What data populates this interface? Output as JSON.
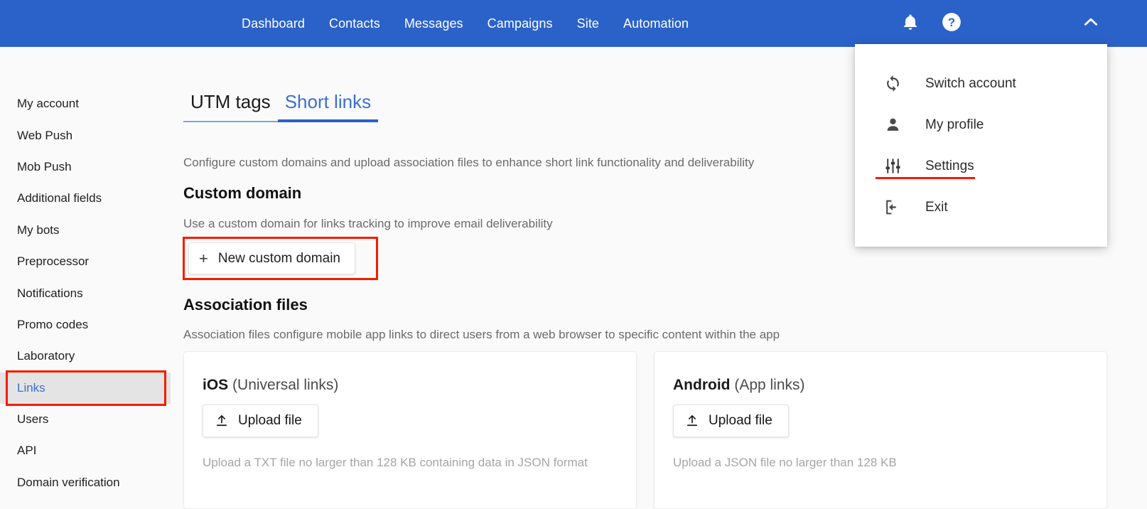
{
  "topnav": {
    "background": "#2b62c9",
    "links": [
      {
        "label": "Dashboard"
      },
      {
        "label": "Contacts"
      },
      {
        "label": "Messages"
      },
      {
        "label": "Campaigns"
      },
      {
        "label": "Site"
      },
      {
        "label": "Automation"
      }
    ],
    "icons": {
      "bell": "bell-icon",
      "help": "help-circle-icon",
      "chevron": "chevron-up-icon"
    }
  },
  "account_menu": {
    "items": [
      {
        "label": "Switch account",
        "icon": "switch-account-icon"
      },
      {
        "label": "My profile",
        "icon": "person-icon"
      },
      {
        "label": "Settings",
        "icon": "sliders-icon"
      },
      {
        "label": "Exit",
        "icon": "exit-icon"
      }
    ],
    "highlight_color": "#f51b00",
    "highlighted_item": "Settings"
  },
  "sidebar": {
    "active_item": "Links",
    "active_color": "#3b6fd4",
    "highlight_color": "#f51b00",
    "items": [
      {
        "label": "My account"
      },
      {
        "label": "Web Push"
      },
      {
        "label": "Mob Push"
      },
      {
        "label": "Additional fields"
      },
      {
        "label": "My bots"
      },
      {
        "label": "Preprocessor"
      },
      {
        "label": "Notifications"
      },
      {
        "label": "Promo codes"
      },
      {
        "label": "Laboratory"
      },
      {
        "label": "Links"
      },
      {
        "label": "Users"
      },
      {
        "label": "API"
      },
      {
        "label": "Domain verification"
      }
    ]
  },
  "main": {
    "tabs": [
      {
        "label": "UTM tags",
        "active": false
      },
      {
        "label": "Short links",
        "active": true
      }
    ],
    "page_description": "Configure custom domains and upload association files to enhance short link functionality and deliverability",
    "custom_domain": {
      "title": "Custom domain",
      "description": "Use a custom domain for links tracking to improve email deliverability",
      "button_label": "New custom domain",
      "button_plus": "+",
      "highlight_color": "#f51b00"
    },
    "association_files": {
      "title": "Association files",
      "description": "Association files configure mobile app links to direct users from a web browser to specific content within the app",
      "cards": [
        {
          "platform": "iOS",
          "subtitle": "(Universal links)",
          "upload_label": "Upload file",
          "hint": "Upload a TXT file no larger than 128 KB containing data in JSON format"
        },
        {
          "platform": "Android",
          "subtitle": "(App links)",
          "upload_label": "Upload file",
          "hint": "Upload a JSON file no larger than 128 KB"
        }
      ]
    }
  }
}
